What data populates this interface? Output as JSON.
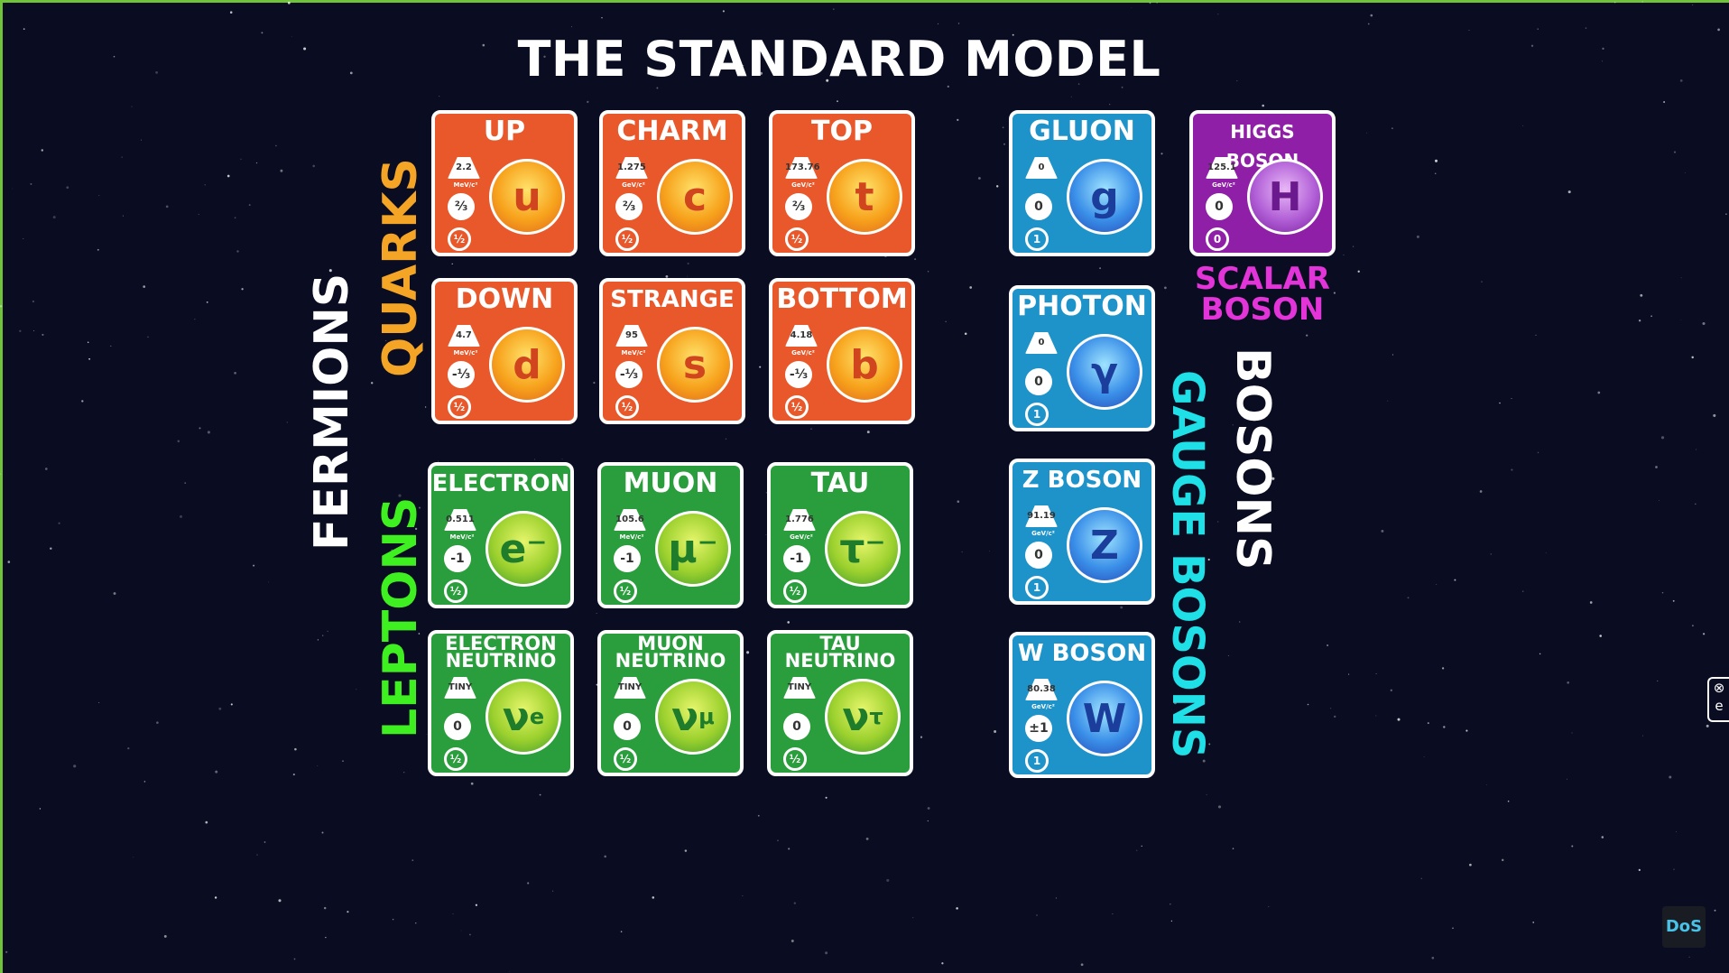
{
  "title": "THE STANDARD MODEL",
  "groups": {
    "fermions": "FERMIONS",
    "quarks": "QUARKS",
    "leptons": "LEPTONS",
    "bosons": "BOSONS",
    "gauge_bosons": "GAUGE BOSONS",
    "scalar_boson": [
      "SCALAR",
      "BOSON"
    ]
  },
  "colors": {
    "quark": "#e8582a",
    "lepton": "#2a9d3c",
    "gauge": "#1e93c9",
    "scalar": "#8e1fa6"
  },
  "particles": [
    {
      "name": "UP",
      "symbol": "u",
      "mass": "2.2",
      "unit": "MeV/c²",
      "charge": "⅔",
      "spin": "½"
    },
    {
      "name": "CHARM",
      "symbol": "c",
      "mass": "1.275",
      "unit": "GeV/c²",
      "charge": "⅔",
      "spin": "½"
    },
    {
      "name": "TOP",
      "symbol": "t",
      "mass": "173.76",
      "unit": "GeV/c²",
      "charge": "⅔",
      "spin": "½"
    },
    {
      "name": "DOWN",
      "symbol": "d",
      "mass": "4.7",
      "unit": "MeV/c²",
      "charge": "-⅓",
      "spin": "½"
    },
    {
      "name": "STRANGE",
      "symbol": "s",
      "mass": "95",
      "unit": "MeV/c²",
      "charge": "-⅓",
      "spin": "½"
    },
    {
      "name": "BOTTOM",
      "symbol": "b",
      "mass": "4.18",
      "unit": "GeV/c²",
      "charge": "-⅓",
      "spin": "½"
    },
    {
      "name": "ELECTRON",
      "symbol": "e⁻",
      "mass": "0.511",
      "unit": "MeV/c²",
      "charge": "-1",
      "spin": "½"
    },
    {
      "name": "MUON",
      "symbol": "μ⁻",
      "mass": "105.6",
      "unit": "MeV/c²",
      "charge": "-1",
      "spin": "½"
    },
    {
      "name": "TAU",
      "symbol": "τ⁻",
      "mass": "1.776",
      "unit": "GeV/c²",
      "charge": "-1",
      "spin": "½"
    },
    {
      "name": "ELECTRON NEUTRINO",
      "symbol": "ν",
      "sub": "e",
      "mass": "TINY",
      "unit": "",
      "charge": "0",
      "spin": "½"
    },
    {
      "name": "MUON NEUTRINO",
      "symbol": "ν",
      "sub": "μ",
      "mass": "TINY",
      "unit": "",
      "charge": "0",
      "spin": "½"
    },
    {
      "name": "TAU NEUTRINO",
      "symbol": "ν",
      "sub": "τ",
      "mass": "TINY",
      "unit": "",
      "charge": "0",
      "spin": "½"
    },
    {
      "name": "GLUON",
      "symbol": "g",
      "mass": "0",
      "unit": "",
      "charge": "0",
      "spin": "1"
    },
    {
      "name": "PHOTON",
      "symbol": "γ",
      "mass": "0",
      "unit": "",
      "charge": "0",
      "spin": "1"
    },
    {
      "name": "Z BOSON",
      "symbol": "Z",
      "mass": "91.19",
      "unit": "GeV/c²",
      "charge": "0",
      "spin": "1"
    },
    {
      "name": "W BOSON",
      "symbol": "W",
      "mass": "80.38",
      "unit": "GeV/c²",
      "charge": "±1",
      "spin": "1"
    },
    {
      "name": "HIGGS BOSON",
      "symbol": "H",
      "mass": "125.1",
      "unit": "GeV/c²",
      "charge": "0",
      "spin": "0"
    }
  ],
  "side_icons": [
    "⊗",
    "e"
  ],
  "logo": "DoS"
}
